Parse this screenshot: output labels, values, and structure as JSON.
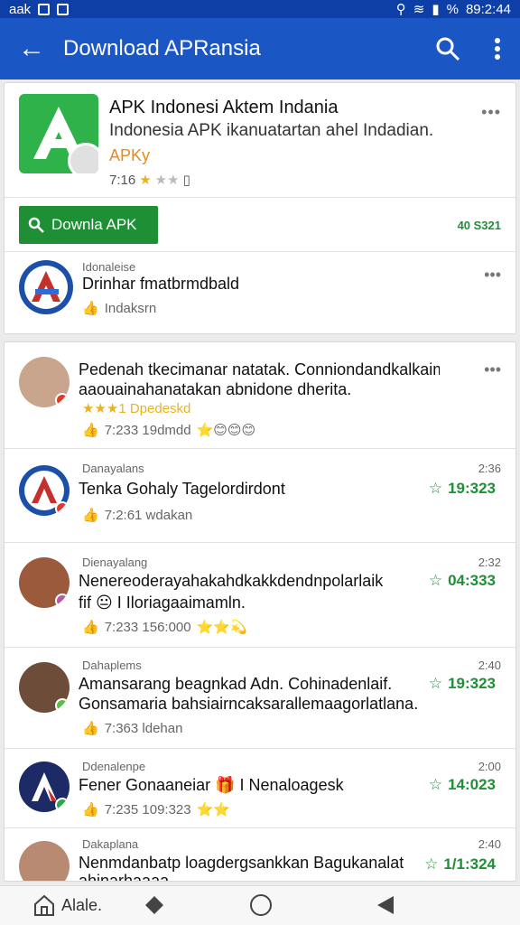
{
  "status_bar": {
    "left_text": "aak",
    "time": "89:2:44",
    "battery": "%"
  },
  "app_bar": {
    "title": "Download APRansia"
  },
  "app": {
    "name": "APK Indonesi Aktem Indania",
    "description": "Indonesia APK ikanuatartan ahel Indadian.",
    "developer": "APKy",
    "meta": "7:16",
    "download_label": "Downla APK",
    "download_count": "40 S321",
    "brand_color": "#2fb24a"
  },
  "related": {
    "tag": "Idonaleise",
    "title": "Drinhar fmatbrmdbald",
    "like_label": "Indaksrn"
  },
  "reviews": [
    {
      "line1": "Pedenah tkecimanar natatak. Conniondandkalkaim,",
      "line2": "aaouainahanatakan abnidone dherita.",
      "rating_text": "★★★1 Dpedeskd",
      "meta": "7:233 19dmdd",
      "emoji": "⭐😊😊😊"
    },
    {
      "tag": "Danayalans",
      "title": "Tenka Gohaly Tagelordirdont",
      "meta": "7:2:61 wdakan",
      "time": "2:36",
      "score": "19:323"
    },
    {
      "tag": "Dienayalang",
      "title": "Nenereoderayahakahdkakkdendnpolarlaik",
      "line2": "fif 😐 I Iloriagaaimamln.",
      "meta": "7:233 156:000",
      "emoji": "⭐⭐💫",
      "time": "2:32",
      "score": "04:333"
    },
    {
      "tag": "Dahaplems",
      "title": "Amansarang beagnkad Adn. Cohinadenlaif.",
      "line2": "Gonsamaria bahsiairncaksarallemaagorlatlana.",
      "meta": "7:363 ldehan",
      "time": "2:40",
      "score": "19:323"
    },
    {
      "tag": "Ddenalenpe",
      "title": "Fener Gonaaneiar 🎁 I Nenaloagesk",
      "meta": "7:235 109:323",
      "emoji": "⭐⭐",
      "time": "2:00",
      "score": "14:023"
    },
    {
      "tag": "Dakaplana",
      "title": "Nenmdanbatp loagdergsankkan Bagukanalat",
      "line2": "ahinarhaaaa",
      "time": "2:40",
      "score": "1/1:324"
    }
  ],
  "bottom_nav": {
    "home_label": "Alale."
  }
}
